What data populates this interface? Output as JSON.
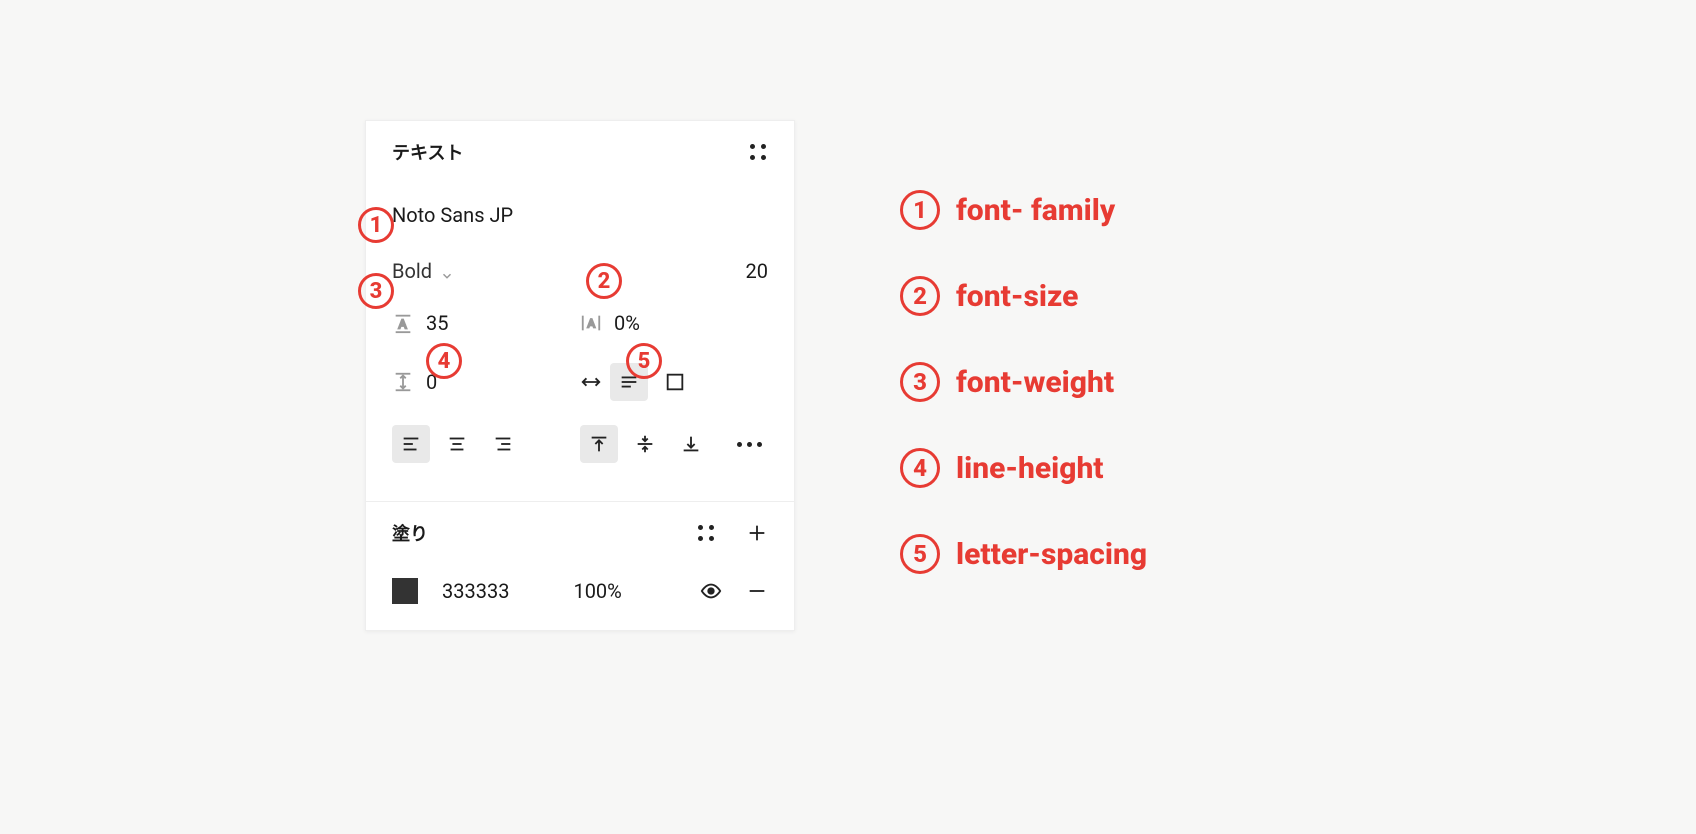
{
  "panel": {
    "text_section": {
      "title": "テキスト",
      "font_family": "Noto Sans JP",
      "font_weight": "Bold",
      "font_size": "20",
      "line_height": "35",
      "letter_spacing": "0%",
      "paragraph_spacing": "0"
    },
    "fill_section": {
      "title": "塗り",
      "color_hex": "333333",
      "opacity": "100%"
    }
  },
  "annotations": {
    "b1": "1",
    "b2": "2",
    "b3": "3",
    "b4": "4",
    "b5": "5"
  },
  "legend": {
    "items": [
      {
        "num": "1",
        "label": "font- family"
      },
      {
        "num": "2",
        "label": "font-size"
      },
      {
        "num": "3",
        "label": "font-weight"
      },
      {
        "num": "4",
        "label": "line-height"
      },
      {
        "num": "5",
        "label": "letter-spacing"
      }
    ]
  }
}
